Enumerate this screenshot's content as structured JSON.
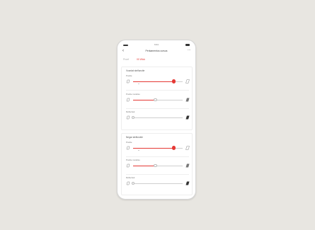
{
  "status": {
    "time": "9:41"
  },
  "nav": {
    "title": "Perkamentus cursus",
    "back_icon": "chevron-left-icon",
    "more_icon": "ellipsis-icon"
  },
  "tabs": [
    {
      "label": "Proef"
    },
    {
      "label": "00 Wick"
    }
  ],
  "cards": [
    {
      "title": "Voordat stelfunctie",
      "rows": [
        {
          "label": "Positie",
          "value": 0.82,
          "style": "red",
          "marker": 0.12
        },
        {
          "label": "Positie modelse",
          "value": 0.45,
          "style": "white"
        },
        {
          "label": "Reflectiek",
          "value": 0.0,
          "style": "white"
        }
      ]
    },
    {
      "title": "Negar stelfunctie",
      "rows": [
        {
          "label": "Positie",
          "value": 0.82,
          "style": "red",
          "marker": 0.12
        },
        {
          "label": "Positie modelse",
          "value": 0.45,
          "style": "white"
        },
        {
          "label": "Reflectiek",
          "value": 0.0,
          "style": "white"
        }
      ]
    }
  ],
  "colors": {
    "accent": "#e53935",
    "track": "#cfcfcf",
    "background": "#e8e6e1"
  }
}
